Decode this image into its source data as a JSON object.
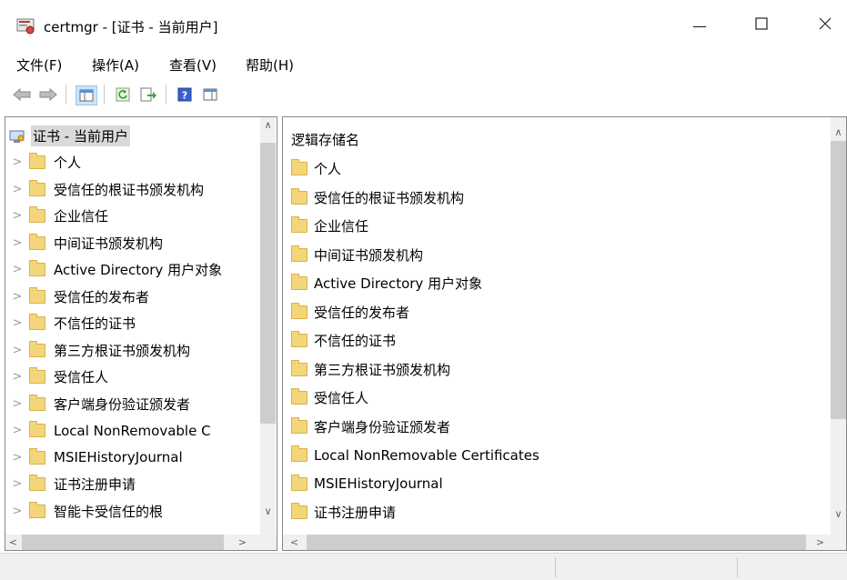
{
  "window": {
    "title": "certmgr - [证书 - 当前用户]",
    "minimize_glyph": "—",
    "maximize_glyph": "☐",
    "close_glyph": "✕"
  },
  "menu": [
    "文件(F)",
    "操作(A)",
    "查看(V)",
    "帮助(H)"
  ],
  "toolbar": [
    "back-icon",
    "forward-icon",
    "show-hide-tree-icon",
    "refresh-icon",
    "export-list-icon",
    "help-icon",
    "properties-icon"
  ],
  "tree": {
    "root": "证书 - 当前用户",
    "items": [
      "个人",
      "受信任的根证书颁发机构",
      "企业信任",
      "中间证书颁发机构",
      "Active Directory 用户对象",
      "受信任的发布者",
      "不信任的证书",
      "第三方根证书颁发机构",
      "受信任人",
      "客户端身份验证颁发者",
      "Local NonRemovable C",
      "MSIEHistoryJournal",
      "证书注册申请",
      "智能卡受信任的根"
    ]
  },
  "list": {
    "header": "逻辑存储名",
    "items": [
      "个人",
      "受信任的根证书颁发机构",
      "企业信任",
      "中间证书颁发机构",
      "Active Directory 用户对象",
      "受信任的发布者",
      "不信任的证书",
      "第三方根证书颁发机构",
      "受信任人",
      "客户端身份验证颁发者",
      "Local NonRemovable Certificates",
      "MSIEHistoryJournal",
      "证书注册申请"
    ]
  },
  "colors": {
    "folder": "#f3d67a",
    "scrollbar": "#f0f0f0",
    "thumb": "#cdcdcd"
  }
}
